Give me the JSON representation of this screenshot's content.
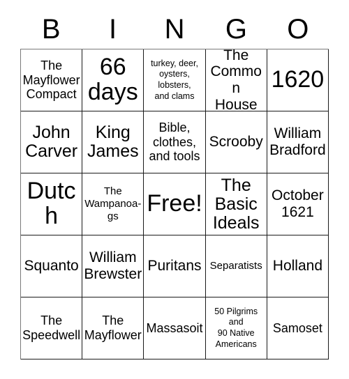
{
  "card": {
    "title": "BINGO",
    "header_letters": [
      "B",
      "I",
      "N",
      "G",
      "O"
    ],
    "border_color": "#1a1a1a",
    "background_color": "#ffffff",
    "text_color": "#000000",
    "rows": 5,
    "columns": 5
  },
  "cells": [
    {
      "id": "b1",
      "column": "B",
      "row": 1,
      "text": "The\nMayflower\nCompact",
      "size": "md",
      "free": false
    },
    {
      "id": "i1",
      "column": "I",
      "row": 1,
      "text": "66\ndays",
      "size": "xxl",
      "free": false
    },
    {
      "id": "n1",
      "column": "N",
      "row": 1,
      "text": "turkey, deer,\noysters,\nlobsters,\nand clams",
      "size": "xs",
      "free": false
    },
    {
      "id": "g1",
      "column": "G",
      "row": 1,
      "text": "The\nCommon\nHouse",
      "size": "lg",
      "free": false
    },
    {
      "id": "o1",
      "column": "O",
      "row": 1,
      "text": "1620",
      "size": "xxl",
      "free": false
    },
    {
      "id": "b2",
      "column": "B",
      "row": 2,
      "text": "John\nCarver",
      "size": "xl",
      "free": false
    },
    {
      "id": "i2",
      "column": "I",
      "row": 2,
      "text": "King\nJames",
      "size": "xl",
      "free": false
    },
    {
      "id": "n2",
      "column": "N",
      "row": 2,
      "text": "Bible,\nclothes,\nand tools",
      "size": "md",
      "free": false
    },
    {
      "id": "g2",
      "column": "G",
      "row": 2,
      "text": "Scrooby",
      "size": "lg",
      "free": false
    },
    {
      "id": "o2",
      "column": "O",
      "row": 2,
      "text": "William\nBradford",
      "size": "lg",
      "free": false
    },
    {
      "id": "b3",
      "column": "B",
      "row": 3,
      "text": "Dutch",
      "size": "xxl",
      "free": false
    },
    {
      "id": "i3",
      "column": "I",
      "row": 3,
      "text": "The\nWampanoa-\ngs",
      "size": "sm",
      "free": false
    },
    {
      "id": "n3",
      "column": "N",
      "row": 3,
      "text": "Free!",
      "size": "xxl",
      "free": true
    },
    {
      "id": "g3",
      "column": "G",
      "row": 3,
      "text": "The\nBasic\nIdeals",
      "size": "xl",
      "free": false
    },
    {
      "id": "o3",
      "column": "O",
      "row": 3,
      "text": "October\n1621",
      "size": "lg",
      "free": false
    },
    {
      "id": "b4",
      "column": "B",
      "row": 4,
      "text": "Squanto",
      "size": "lg",
      "free": false
    },
    {
      "id": "i4",
      "column": "I",
      "row": 4,
      "text": "William\nBrewster",
      "size": "lg",
      "free": false
    },
    {
      "id": "n4",
      "column": "N",
      "row": 4,
      "text": "Puritans",
      "size": "lg",
      "free": false
    },
    {
      "id": "g4",
      "column": "G",
      "row": 4,
      "text": "Separatists",
      "size": "sm",
      "free": false
    },
    {
      "id": "o4",
      "column": "O",
      "row": 4,
      "text": "Holland",
      "size": "lg",
      "free": false
    },
    {
      "id": "b5",
      "column": "B",
      "row": 5,
      "text": "The\nSpeedwell",
      "size": "md",
      "free": false
    },
    {
      "id": "i5",
      "column": "I",
      "row": 5,
      "text": "The\nMayflower",
      "size": "md",
      "free": false
    },
    {
      "id": "n5",
      "column": "N",
      "row": 5,
      "text": "Massasoit",
      "size": "md",
      "free": false
    },
    {
      "id": "g5",
      "column": "G",
      "row": 5,
      "text": "50 Pilgrims\nand\n90 Native\nAmericans",
      "size": "xs",
      "free": false
    },
    {
      "id": "o5",
      "column": "O",
      "row": 5,
      "text": "Samoset",
      "size": "md",
      "free": false
    }
  ]
}
